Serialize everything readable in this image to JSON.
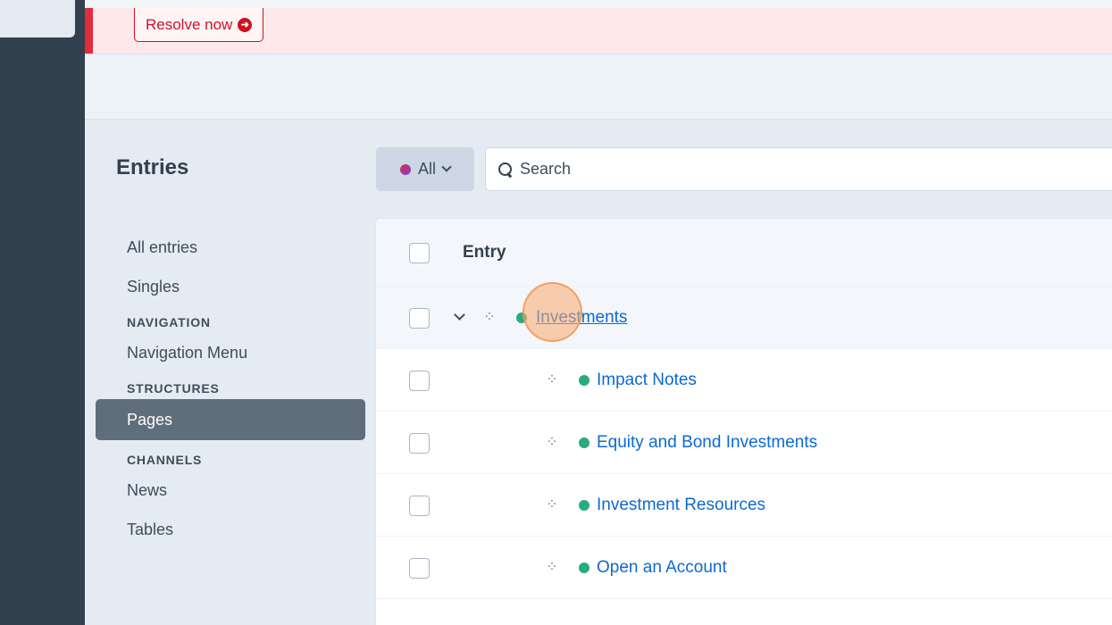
{
  "alert": {
    "resolve_label": "Resolve now"
  },
  "page": {
    "title": "Entries"
  },
  "subnav": {
    "all_entries": "All entries",
    "singles": "Singles",
    "navigation_heading": "NAVIGATION",
    "navigation_menu": "Navigation Menu",
    "structures_heading": "STRUCTURES",
    "pages": "Pages",
    "channels_heading": "CHANNELS",
    "news": "News",
    "tables": "Tables"
  },
  "toolbar": {
    "site_label": "All",
    "search_placeholder": "Search"
  },
  "table": {
    "column_entry": "Entry",
    "rows": [
      {
        "title": "Investments",
        "status": "enabled",
        "level": 1,
        "expanded": true
      },
      {
        "title": "Impact Notes",
        "status": "enabled",
        "level": 2
      },
      {
        "title": "Equity and Bond Investments",
        "status": "enabled",
        "level": 2
      },
      {
        "title": "Investment Resources",
        "status": "enabled",
        "level": 2
      },
      {
        "title": "Open an Account",
        "status": "enabled",
        "level": 2
      }
    ]
  },
  "colors": {
    "sidebar": "#33404d",
    "alert_red": "#cf1124",
    "link_blue": "#0b69d4",
    "status_green": "#27ab83",
    "selected_nav": "#606d7b"
  },
  "icons": {
    "resolve": "arrow-circle-right-icon",
    "search": "search-icon",
    "site": "site-dot-icon",
    "expand": "chevron-down-icon",
    "drag": "move-icon"
  }
}
